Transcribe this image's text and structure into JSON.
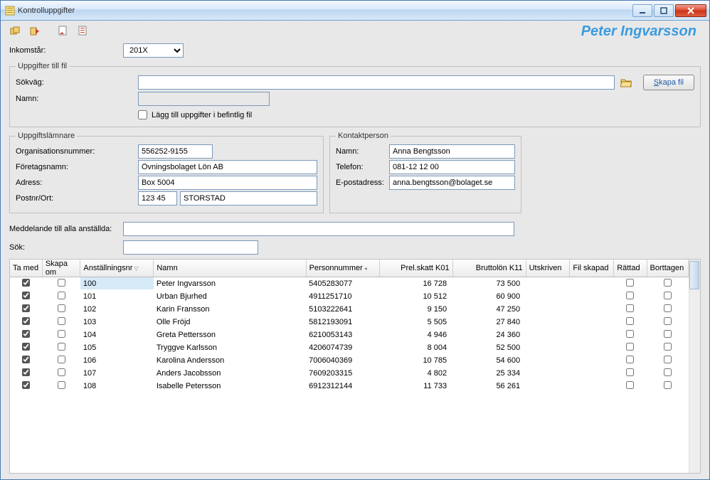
{
  "window": {
    "title": "Kontrolluppgifter"
  },
  "toolbar": {
    "user": "Peter Ingvarsson"
  },
  "incomeYear": {
    "label": "Inkomstår:",
    "value": "201X"
  },
  "fileGroup": {
    "legend": "Uppgifter till fil",
    "pathLabel": "Sökväg:",
    "nameLabel": "Namn:",
    "path": "",
    "name": "",
    "createFileBtn": "Skapa fil",
    "appendCheckbox": "Lägg till uppgifter i befintlig fil"
  },
  "provider": {
    "legend": "Uppgiftslämnare",
    "orgLabel": "Organisationsnummer:",
    "companyLabel": "Företagsnamn:",
    "addressLabel": "Adress:",
    "postalLabel": "Postnr/Ort:",
    "org": "556252-9155",
    "company": "Övningsbolaget Lön AB",
    "address": "Box 5004",
    "postal": "123 45",
    "city": "STORSTAD"
  },
  "contact": {
    "legend": "Kontaktperson",
    "nameLabel": "Namn:",
    "phoneLabel": "Telefon:",
    "emailLabel": "E-postadress:",
    "name": "Anna Bengtsson",
    "phone": "081-12 12 00",
    "email": "anna.bengtsson@bolaget.se"
  },
  "message": {
    "label": "Meddelande till alla anställda:",
    "value": ""
  },
  "search": {
    "label": "Sök:",
    "value": ""
  },
  "table": {
    "headers": {
      "include": "Ta med",
      "recreate": "Skapa om",
      "empNo": "Anställningsnr",
      "name": "Namn",
      "ssn": "Personnummer",
      "preTax": "Prel.skatt K01",
      "gross": "Bruttolön K11",
      "printed": "Utskriven",
      "fileCreated": "Fil skapad",
      "corrected": "Rättad",
      "removed": "Borttagen"
    },
    "rows": [
      {
        "include": true,
        "recreate": false,
        "empNo": "100",
        "name": "Peter Ingvarsson",
        "ssn": "5405283077",
        "preTax": "16 728",
        "gross": "73 500",
        "corrected": false,
        "removed": false,
        "selected": true
      },
      {
        "include": true,
        "recreate": false,
        "empNo": "101",
        "name": "Urban Bjurhed",
        "ssn": "4911251710",
        "preTax": "10 512",
        "gross": "60 900",
        "corrected": false,
        "removed": false
      },
      {
        "include": true,
        "recreate": false,
        "empNo": "102",
        "name": "Karin Fransson",
        "ssn": "5103222641",
        "preTax": "9 150",
        "gross": "47 250",
        "corrected": false,
        "removed": false
      },
      {
        "include": true,
        "recreate": false,
        "empNo": "103",
        "name": "Olle Fröjd",
        "ssn": "5812193091",
        "preTax": "5 505",
        "gross": "27 840",
        "corrected": false,
        "removed": false
      },
      {
        "include": true,
        "recreate": false,
        "empNo": "104",
        "name": "Greta Pettersson",
        "ssn": "6210053143",
        "preTax": "4 946",
        "gross": "24 360",
        "corrected": false,
        "removed": false
      },
      {
        "include": true,
        "recreate": false,
        "empNo": "105",
        "name": "Tryggve Karlsson",
        "ssn": "4206074739",
        "preTax": "8 004",
        "gross": "52 500",
        "corrected": false,
        "removed": false
      },
      {
        "include": true,
        "recreate": false,
        "empNo": "106",
        "name": "Karolina Andersson",
        "ssn": "7006040369",
        "preTax": "10 785",
        "gross": "54 600",
        "corrected": false,
        "removed": false
      },
      {
        "include": true,
        "recreate": false,
        "empNo": "107",
        "name": "Anders Jacobsson",
        "ssn": "7609203315",
        "preTax": "4 802",
        "gross": "25 334",
        "corrected": false,
        "removed": false
      },
      {
        "include": true,
        "recreate": false,
        "empNo": "108",
        "name": "Isabelle Petersson",
        "ssn": "6912312144",
        "preTax": "11 733",
        "gross": "56 261",
        "corrected": false,
        "removed": false
      }
    ]
  }
}
